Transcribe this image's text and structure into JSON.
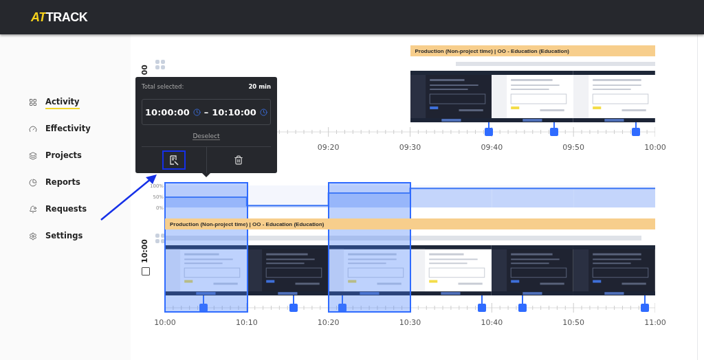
{
  "header": {
    "logo_accent": "AT",
    "logo_rest": "TRACK"
  },
  "sidebar": {
    "items": [
      {
        "label": "Activity",
        "selected": true
      },
      {
        "label": "Effectivity",
        "selected": false
      },
      {
        "label": "Projects",
        "selected": false
      },
      {
        "label": "Reports",
        "selected": false
      },
      {
        "label": "Requests",
        "selected": false
      },
      {
        "label": "Settings",
        "selected": false
      }
    ]
  },
  "timeline": {
    "blocks": [
      {
        "kind": "partial",
        "hour_label": "00",
        "project": "Production (Non-project time) | OO - Education (Education)",
        "screenshots": [
          {
            "kind": "picture"
          },
          {
            "kind": "picture"
          },
          {
            "kind": "picture"
          }
        ],
        "time_labels": [
          "09:20",
          "09:30",
          "09:40",
          "09:50",
          "10:00"
        ]
      },
      {
        "kind": "full",
        "hour_label": "10:00",
        "checked": false,
        "activity_ticks": [
          "100%",
          "50%",
          "0%"
        ],
        "activity": [
          {
            "selected": true
          },
          {
            "selected": false
          },
          {
            "selected": true
          },
          {
            "selected": false
          },
          {
            "selected": false
          },
          {
            "selected": false
          }
        ],
        "project": "Production (Non-project time) | OO - Education (Education)",
        "screenshots": [
          {
            "kind": "picture"
          },
          {
            "kind": "picture"
          },
          {
            "kind": "picture"
          },
          {
            "kind": "picture"
          },
          {
            "kind": "picture"
          },
          {
            "kind": "picture"
          }
        ],
        "time_labels": [
          "10:00",
          "10:10",
          "10:20",
          "10:30",
          "10:40",
          "10:50",
          "11:00"
        ]
      }
    ]
  },
  "popup": {
    "title": "Total selected:",
    "total": "20 min",
    "start": "10:00:00",
    "separator": "–",
    "end": "10:10:00",
    "deselect": "Deselect"
  }
}
